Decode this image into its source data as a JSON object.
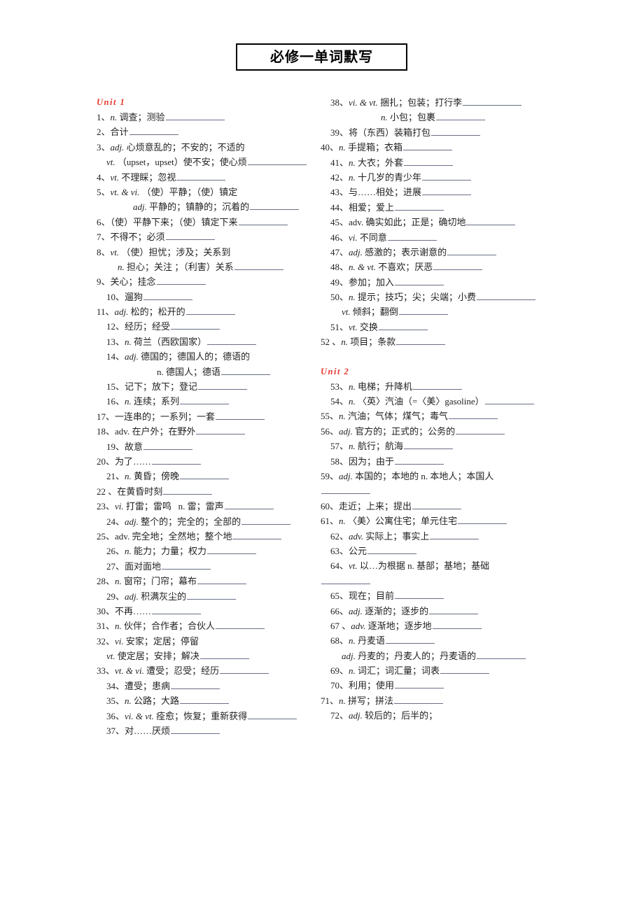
{
  "document": {
    "title": "必修一单词默写"
  },
  "left_column": {
    "unit_label": "Unit 1",
    "items": [
      {
        "num": "1、",
        "pos": "n.",
        "pos_style": "italic",
        "text": "调查；测验",
        "blank": "b-l"
      },
      {
        "num": "2、",
        "pos": "",
        "pos_style": "none",
        "text": "合计",
        "blank": "b-m"
      },
      {
        "num": "3、",
        "pos": "adj.",
        "pos_style": "italic",
        "text": "心烦意乱的；不安的；不适的",
        "blank": "none"
      },
      {
        "num": "",
        "pos": "vt.",
        "pos_style": "italic",
        "text": "（upset，upset）使不安；使心烦",
        "blank": "b-l",
        "indent": "ind1"
      },
      {
        "num": "4、",
        "pos": "vt.",
        "pos_style": "italic",
        "text": "不理睬；忽视",
        "blank": "b-m"
      },
      {
        "num": "5、",
        "pos": "vt. & vi.",
        "pos_style": "italic",
        "text": "（使）平静；（使）镇定",
        "blank": "none"
      },
      {
        "num": "",
        "pos": "adj.",
        "pos_style": "italic",
        "text": "平静的；镇静的；沉着的",
        "blank": "b-m",
        "indent": "ind3"
      },
      {
        "num": "6、",
        "pos": "",
        "pos_style": "none",
        "text": "（使）平静下来；（使）镇定下来",
        "blank": "b-m"
      },
      {
        "num": "7、",
        "pos": "",
        "pos_style": "none",
        "text": "不得不；必须",
        "blank": "b-m"
      },
      {
        "num": "8、",
        "pos": "vt.",
        "pos_style": "italic",
        "text": "（使）担忧；涉及；关系到",
        "blank": "none"
      },
      {
        "num": "",
        "pos": "n.",
        "pos_style": "italic",
        "text": "担心；关注 ；（利害）关系",
        "blank": "b-m",
        "indent": "ind2"
      },
      {
        "num": "9、",
        "pos": "",
        "pos_style": "none",
        "text": "关心；挂念",
        "blank": "b-m"
      },
      {
        "num": "10、",
        "pos": "",
        "pos_style": "none",
        "text": "遛狗",
        "blank": "b-m",
        "indent": "ind1"
      },
      {
        "num": "11、",
        "pos": "adj.",
        "pos_style": "italic",
        "text": "松的；松开的",
        "blank": "b-m"
      },
      {
        "num": "12、",
        "pos": "",
        "pos_style": "none",
        "text": "经历；经受",
        "blank": "b-m",
        "indent": "ind1"
      },
      {
        "num": "13、",
        "pos": "n.",
        "pos_style": "italic",
        "text": "荷兰（西欧国家）",
        "blank": "b-m",
        "indent": "ind1"
      },
      {
        "num": "14、",
        "pos": "adj.",
        "pos_style": "italic",
        "text": "德国的；德国人的；德语的",
        "blank": "none",
        "indent": "ind1"
      },
      {
        "num": "",
        "pos": "n.",
        "pos_style": "normal",
        "text": "德国人；德语",
        "blank": "b-m",
        "indent": "ind4"
      },
      {
        "num": "15、",
        "pos": "",
        "pos_style": "none",
        "text": "记下；放下；登记",
        "blank": "b-m",
        "indent": "ind1"
      },
      {
        "num": "16、",
        "pos": "n.",
        "pos_style": "italic",
        "text": "连续；系列",
        "blank": "b-m",
        "indent": "ind1"
      },
      {
        "num": "17、",
        "pos": "",
        "pos_style": "none",
        "text": "一连串的；一系列；一套",
        "blank": "b-m"
      },
      {
        "num": "18、",
        "pos": "adv.",
        "pos_style": "normal",
        "text": "在户外；在野外",
        "blank": "b-m"
      },
      {
        "num": "19、",
        "pos": "",
        "pos_style": "none",
        "text": "故意",
        "blank": "b-m",
        "indent": "ind1"
      },
      {
        "num": "20、",
        "pos": "",
        "pos_style": "none",
        "text": "为了……",
        "blank": "b-m"
      },
      {
        "num": "21、",
        "pos": "n.",
        "pos_style": "italic",
        "text": "黄昏；傍晚",
        "blank": "b-m",
        "indent": "ind1"
      },
      {
        "num": "22 、",
        "pos": "",
        "pos_style": "none",
        "text": "在黄昏时刻",
        "blank": "b-m"
      },
      {
        "num": "23、",
        "pos": "vi.",
        "pos_style": "italic",
        "text": "打雷；雷鸣",
        "text2": "n. 雷；雷声",
        "blank": "b-m"
      },
      {
        "num": "24、",
        "pos": "adj.",
        "pos_style": "italic",
        "text": "整个的；完全的；全部的",
        "blank": "b-m",
        "indent": "ind1"
      },
      {
        "num": "25、",
        "pos": "adv.",
        "pos_style": "normal",
        "text": "完全地；全然地；整个地",
        "blank": "b-m"
      },
      {
        "num": "26、",
        "pos": "n.",
        "pos_style": "italic",
        "text": "能力；力量；权力",
        "blank": "b-m",
        "indent": "ind1"
      },
      {
        "num": "27、",
        "pos": "",
        "pos_style": "none",
        "text": "面对面地",
        "blank": "b-m",
        "indent": "ind1"
      },
      {
        "num": "28、",
        "pos": "n.",
        "pos_style": "italic",
        "text": "窗帘；门帘；幕布",
        "blank": "b-m"
      },
      {
        "num": "29、",
        "pos": "adj.",
        "pos_style": "italic",
        "text": "积满灰尘的",
        "blank": "b-m",
        "indent": "ind1"
      },
      {
        "num": "30、",
        "pos": "",
        "pos_style": "none",
        "text": "不再……",
        "blank": "b-m"
      },
      {
        "num": "31、",
        "pos": "n.",
        "pos_style": "italic",
        "text": "伙伴；合作者；合伙人",
        "blank": "b-m"
      },
      {
        "num": "32、",
        "pos": "vi.",
        "pos_style": "italic",
        "text": "安家；定居；停留",
        "blank": "none"
      },
      {
        "num": "",
        "pos": "vt.",
        "pos_style": "italic",
        "text": "使定居；安排；解决",
        "blank": "b-m",
        "indent": "ind1"
      },
      {
        "num": "33、",
        "pos": "vt. & vi.",
        "pos_style": "italic",
        "text": "遭受；忍受；经历",
        "blank": "b-m"
      },
      {
        "num": "34、",
        "pos": "",
        "pos_style": "none",
        "text": "遭受；患病",
        "blank": "b-m",
        "indent": "ind1"
      },
      {
        "num": "35、",
        "pos": "n.",
        "pos_style": "italic",
        "text": "公路；大路",
        "blank": "b-m",
        "indent": "ind1"
      },
      {
        "num": "36、",
        "pos": "vi. & vt.",
        "pos_style": "italic",
        "text": "痊愈；恢复；重新获得",
        "blank": "b-m",
        "indent": "ind1"
      },
      {
        "num": "37、",
        "pos": "",
        "pos_style": "none",
        "text": "对……厌烦",
        "blank": "b-m",
        "indent": "ind1"
      }
    ]
  },
  "right_column": {
    "unit_label": "Unit 2",
    "items_unit1": [
      {
        "num": "38、",
        "pos": "vi. & vt.",
        "pos_style": "italic",
        "text": "捆扎；包装；打行李",
        "blank": "b-l",
        "indent": "ind1"
      },
      {
        "num": "",
        "pos": "n.",
        "pos_style": "italic",
        "text": "小包；包裹",
        "blank": "b-m",
        "indent": "ind4"
      },
      {
        "num": "39、",
        "pos": "",
        "pos_style": "none",
        "text": "将（东西）装箱打包",
        "blank": "b-m",
        "indent": "ind1"
      },
      {
        "num": "40、",
        "pos": "n.",
        "pos_style": "italic",
        "text": "手提箱；衣箱",
        "blank": "b-m"
      },
      {
        "num": "41、",
        "pos": "n.",
        "pos_style": "italic",
        "text": "大衣；外套",
        "blank": "b-m",
        "indent": "ind1"
      },
      {
        "num": "42、",
        "pos": "n.",
        "pos_style": "italic",
        "text": "十几岁的青少年",
        "blank": "b-m",
        "indent": "ind1"
      },
      {
        "num": "43、",
        "pos": "",
        "pos_style": "none",
        "text": "与……相处；进展",
        "blank": "b-m",
        "indent": "ind1"
      },
      {
        "num": "44、",
        "pos": "",
        "pos_style": "none",
        "text": "相爱；爱上",
        "blank": "b-m",
        "indent": "ind1"
      },
      {
        "num": "45、",
        "pos": "adv.",
        "pos_style": "normal",
        "text": "确实如此；正是；确切地",
        "blank": "b-m",
        "indent": "ind1"
      },
      {
        "num": "46、",
        "pos": "vi.",
        "pos_style": "italic",
        "text": "不同意",
        "blank": "b-m",
        "indent": "ind1"
      },
      {
        "num": "47、",
        "pos": "adj.",
        "pos_style": "italic",
        "text": "感激的；表示谢意的",
        "blank": "b-m",
        "indent": "ind1"
      },
      {
        "num": "48、",
        "pos": "n. & vt.",
        "pos_style": "italic",
        "text": "不喜欢；厌恶",
        "blank": "b-m",
        "indent": "ind1"
      },
      {
        "num": "49、",
        "pos": "",
        "pos_style": "none",
        "text": "参加；加入",
        "blank": "b-m",
        "indent": "ind1"
      },
      {
        "num": "50、",
        "pos": "n.",
        "pos_style": "italic",
        "text": "提示；技巧；尖；尖端；小费",
        "blank": "b-l",
        "indent": "ind1"
      },
      {
        "num": "",
        "pos": "vt.",
        "pos_style": "italic",
        "text": "倾斜；翻倒",
        "blank": "b-m",
        "indent": "ind2"
      },
      {
        "num": "51、",
        "pos": "vt.",
        "pos_style": "italic",
        "text": "交换",
        "blank": "b-m",
        "indent": "ind1"
      },
      {
        "num": "52 、",
        "pos": "n.",
        "pos_style": "italic",
        "text": "项目；条款",
        "blank": "b-m"
      }
    ],
    "items_unit2": [
      {
        "num": "53、",
        "pos": "n.",
        "pos_style": "italic",
        "text": "电梯；升降机",
        "blank": "b-m",
        "indent": "ind1"
      },
      {
        "num": "54、",
        "pos": "n.",
        "pos_style": "italic",
        "text": "〈英〉汽油（=〈美〉gasoline）",
        "blank": "b-m",
        "indent": "ind1"
      },
      {
        "num": "55、",
        "pos": "n.",
        "pos_style": "italic",
        "text": "汽油；气体；煤气；毒气",
        "blank": "b-m"
      },
      {
        "num": "56、",
        "pos": "adj.",
        "pos_style": "italic",
        "text": "官方的；正式的；公务的",
        "blank": "b-m"
      },
      {
        "num": "57、",
        "pos": "n.",
        "pos_style": "italic",
        "text": "航行；航海",
        "blank": "b-m",
        "indent": "ind1"
      },
      {
        "num": "58、",
        "pos": "",
        "pos_style": "none",
        "text": "因为；由于",
        "blank": "b-m",
        "indent": "ind1"
      },
      {
        "num": "59、",
        "pos": "adj.",
        "pos_style": "italic",
        "text": "本国的；本地的 n. 本地人；本国人",
        "blank": "none"
      },
      {
        "num": "",
        "pos": "",
        "pos_style": "none",
        "text": "",
        "blank": "b-m",
        "indent": "ind0"
      },
      {
        "num": "60、",
        "pos": "",
        "pos_style": "none",
        "text": "走近；上来；提出",
        "blank": "b-m"
      },
      {
        "num": "61、",
        "pos": "n.",
        "pos_style": "italic",
        "text": "〈美〉公寓住宅；单元住宅",
        "blank": "b-m"
      },
      {
        "num": "62、",
        "pos": "adv.",
        "pos_style": "italic",
        "text": "实际上；事实上",
        "blank": "b-m",
        "indent": "ind1"
      },
      {
        "num": "63、",
        "pos": "",
        "pos_style": "none",
        "text": "公元",
        "blank": "b-m",
        "indent": "ind1"
      },
      {
        "num": "64、",
        "pos": "vt.",
        "pos_style": "italic",
        "text": "以…为根据 n. 基部；基地；基础",
        "blank": "none",
        "indent": "ind1"
      },
      {
        "num": "",
        "pos": "",
        "pos_style": "none",
        "text": "",
        "blank": "b-m",
        "indent": "ind0"
      },
      {
        "num": "65、",
        "pos": "",
        "pos_style": "none",
        "text": "现在；目前",
        "blank": "b-m",
        "indent": "ind1"
      },
      {
        "num": "66、",
        "pos": "adj.",
        "pos_style": "italic",
        "text": "逐渐的；逐步的",
        "blank": "b-m",
        "indent": "ind1"
      },
      {
        "num": "67 、",
        "pos": "adv.",
        "pos_style": "italic",
        "text": "逐渐地；逐步地",
        "blank": "b-m",
        "indent": "ind1"
      },
      {
        "num": "68、",
        "pos": "n.",
        "pos_style": "italic",
        "text": "丹麦语",
        "blank": "b-m",
        "indent": "ind1"
      },
      {
        "num": "",
        "pos": "adj.",
        "pos_style": "italic",
        "text": "丹麦的；丹麦人的；丹麦语的",
        "blank": "b-m",
        "indent": "ind2"
      },
      {
        "num": "69、",
        "pos": "n.",
        "pos_style": "italic",
        "text": "词汇；词汇量；词表",
        "blank": "b-m",
        "indent": "ind1"
      },
      {
        "num": "70、",
        "pos": "",
        "pos_style": "none",
        "text": "利用；使用",
        "blank": "b-m",
        "indent": "ind1"
      },
      {
        "num": "71、",
        "pos": "n.",
        "pos_style": "italic",
        "text": "拼写；拼法",
        "blank": "b-m"
      },
      {
        "num": "72、",
        "pos": "adj.",
        "pos_style": "italic",
        "text": "较后的；后半的；",
        "blank": "none",
        "indent": "ind1"
      }
    ]
  }
}
